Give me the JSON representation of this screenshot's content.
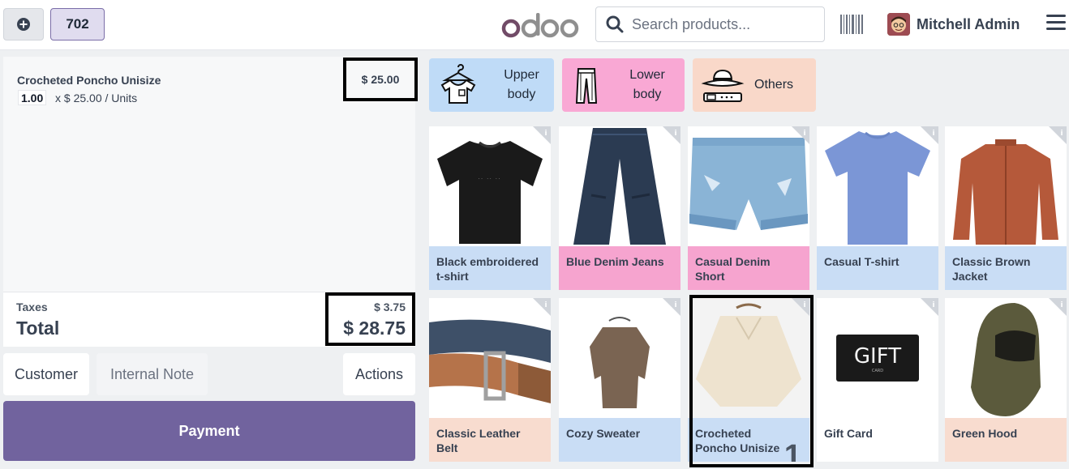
{
  "header": {
    "order_number": "702",
    "search_placeholder": "Search products...",
    "user_name": "Mitchell Admin",
    "logo_text": "odoo"
  },
  "order": {
    "lines": [
      {
        "name": "Crocheted Poncho Unisize",
        "qty": "1.00",
        "unit_price": "x $ 25.00 / Units",
        "price": "$ 25.00"
      }
    ],
    "taxes_label": "Taxes",
    "taxes_value": "$ 3.75",
    "total_label": "Total",
    "total_value": "$ 28.75"
  },
  "controls": {
    "customer": "Customer",
    "internal_note": "Internal Note",
    "actions": "Actions",
    "payment": "Payment"
  },
  "categories": [
    {
      "label": "Upper body",
      "color": "#bfdbf7"
    },
    {
      "label": "Lower body",
      "color": "#f9a8d4"
    },
    {
      "label": "Others",
      "color": "#f9d8c9"
    }
  ],
  "products": [
    {
      "name": "Black embroidered t-shirt",
      "category_color": "blue"
    },
    {
      "name": "Blue Denim Jeans",
      "category_color": "pink"
    },
    {
      "name": "Casual Denim Short",
      "category_color": "pink"
    },
    {
      "name": "Casual T-shirt",
      "category_color": "blue"
    },
    {
      "name": "Classic Brown Jacket",
      "category_color": "blue"
    },
    {
      "name": "Classic Leather Belt",
      "category_color": "peach"
    },
    {
      "name": "Cozy Sweater",
      "category_color": "blue"
    },
    {
      "name": "Crocheted Poncho Unisize",
      "category_color": "blue",
      "cart_qty": "1"
    },
    {
      "name": "Gift Card",
      "category_color": "white"
    },
    {
      "name": "Green Hood",
      "category_color": "peach"
    }
  ],
  "gift_card_text": "GIFT",
  "gift_card_subtext": "CARD",
  "colors": {
    "brand": "#714b67",
    "payment": "#71639e"
  }
}
